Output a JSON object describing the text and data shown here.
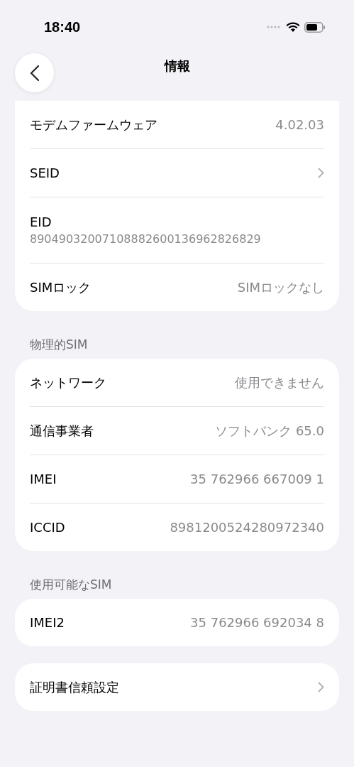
{
  "status_bar": {
    "time": "18:40"
  },
  "nav": {
    "title": "情報"
  },
  "sections": [
    {
      "rows": [
        {
          "kind": "value",
          "label": "モデムファームウェア",
          "value": "4.02.03"
        },
        {
          "kind": "link",
          "label": "SEID"
        },
        {
          "kind": "stacked",
          "label": "EID",
          "value": "89049032007108882600136962826829"
        },
        {
          "kind": "value",
          "label": "SIMロック",
          "value": "SIMロックなし"
        }
      ]
    },
    {
      "header": "物理的SIM",
      "rows": [
        {
          "kind": "value",
          "label": "ネットワーク",
          "value": "使用できません"
        },
        {
          "kind": "value",
          "label": "通信事業者",
          "value": "ソフトバンク 65.0"
        },
        {
          "kind": "value",
          "label": "IMEI",
          "value": "35 762966 667009 1"
        },
        {
          "kind": "value",
          "label": "ICCID",
          "value": "8981200524280972340"
        }
      ]
    },
    {
      "header": "使用可能なSIM",
      "rows": [
        {
          "kind": "value",
          "label": "IMEI2",
          "value": "35 762966 692034 8"
        }
      ]
    },
    {
      "rows": [
        {
          "kind": "link",
          "label": "証明書信頼設定"
        }
      ]
    }
  ]
}
